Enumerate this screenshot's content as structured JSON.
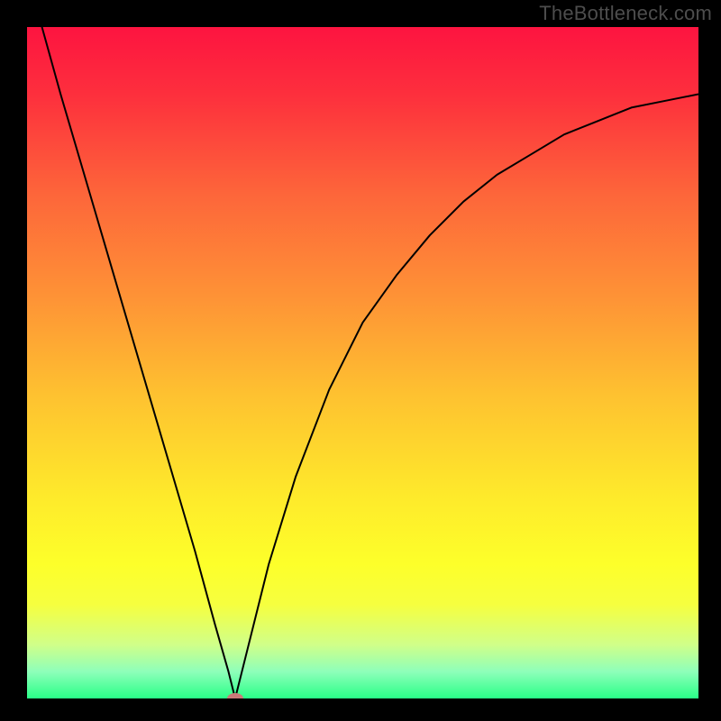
{
  "watermark": "TheBottleneck.com",
  "colors": {
    "black": "#000000",
    "watermark": "#4d4d4d",
    "curve": "#000000",
    "marker": "#cb7a79",
    "gradient_stops": [
      {
        "offset": 0.0,
        "color": "#fd1440"
      },
      {
        "offset": 0.1,
        "color": "#fd2f3d"
      },
      {
        "offset": 0.25,
        "color": "#fd663a"
      },
      {
        "offset": 0.4,
        "color": "#fe9236"
      },
      {
        "offset": 0.55,
        "color": "#fec230"
      },
      {
        "offset": 0.7,
        "color": "#feea2b"
      },
      {
        "offset": 0.8,
        "color": "#fdff2a"
      },
      {
        "offset": 0.86,
        "color": "#f6ff3f"
      },
      {
        "offset": 0.92,
        "color": "#d0ff89"
      },
      {
        "offset": 0.96,
        "color": "#8effba"
      },
      {
        "offset": 1.0,
        "color": "#29ff87"
      }
    ]
  },
  "chart_data": {
    "type": "line",
    "title": "",
    "xlabel": "",
    "ylabel": "",
    "xlim": [
      0,
      100
    ],
    "ylim": [
      0,
      100
    ],
    "grid": false,
    "legend": false,
    "minimum_marker": {
      "x": 31,
      "y": 0
    },
    "series": [
      {
        "name": "bottleneck-curve",
        "x": [
          0,
          5,
          10,
          15,
          20,
          25,
          28,
          30,
          31,
          32,
          34,
          36,
          40,
          45,
          50,
          55,
          60,
          65,
          70,
          75,
          80,
          85,
          90,
          95,
          100
        ],
        "y": [
          108,
          90,
          73,
          56,
          39,
          22,
          11,
          4,
          0,
          4,
          12,
          20,
          33,
          46,
          56,
          63,
          69,
          74,
          78,
          81,
          84,
          86,
          88,
          89,
          90
        ]
      }
    ]
  }
}
